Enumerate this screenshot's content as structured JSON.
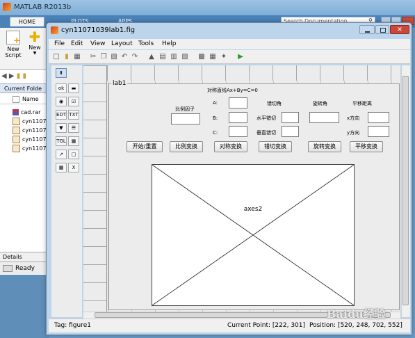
{
  "desktop": {
    "title": "MATLAB R2013b",
    "tabs": [
      "HOME",
      "PLOTS",
      "APPS"
    ],
    "search_placeholder": "Search Documentation",
    "ribbon": {
      "new_script": "New\nScript",
      "new": "New"
    },
    "current_folder_label": "Current Folde",
    "name_column": "Name",
    "files": [
      "cad.rar",
      "cyn1107",
      "cyn1107",
      "cyn1107",
      "cyn1107"
    ],
    "details_label": "Details",
    "status": "Ready"
  },
  "window": {
    "title": "cyn11071039lab1.fig",
    "menu": [
      "File",
      "Edit",
      "View",
      "Layout",
      "Tools",
      "Help"
    ]
  },
  "layout_panel": {
    "title": "lab1",
    "header": "对称直线Ax+By=C=0",
    "scale_factor_label": "比例因子",
    "a_label": "A:",
    "b_label": "B:",
    "c_label": "C:",
    "shear_angle_label": "错切角",
    "horizontal_shear_label": "水平错切",
    "vertical_shear_label": "垂直错切",
    "rotation_angle_label": "旋转角",
    "translation_label": "平移距离",
    "x_dir_label": "x方向",
    "y_dir_label": "y方向"
  },
  "buttons": [
    "开始/重置",
    "比例变换",
    "对称变换",
    "错切变换",
    "旋转变换",
    "平移变换"
  ],
  "axes_label": "axes2",
  "statusbar": {
    "tag": "Tag: figure1",
    "current_point": "Current Point:  [222, 301]",
    "position": "Position: [520, 248, 702, 552]"
  },
  "watermark": "Baidu经验"
}
